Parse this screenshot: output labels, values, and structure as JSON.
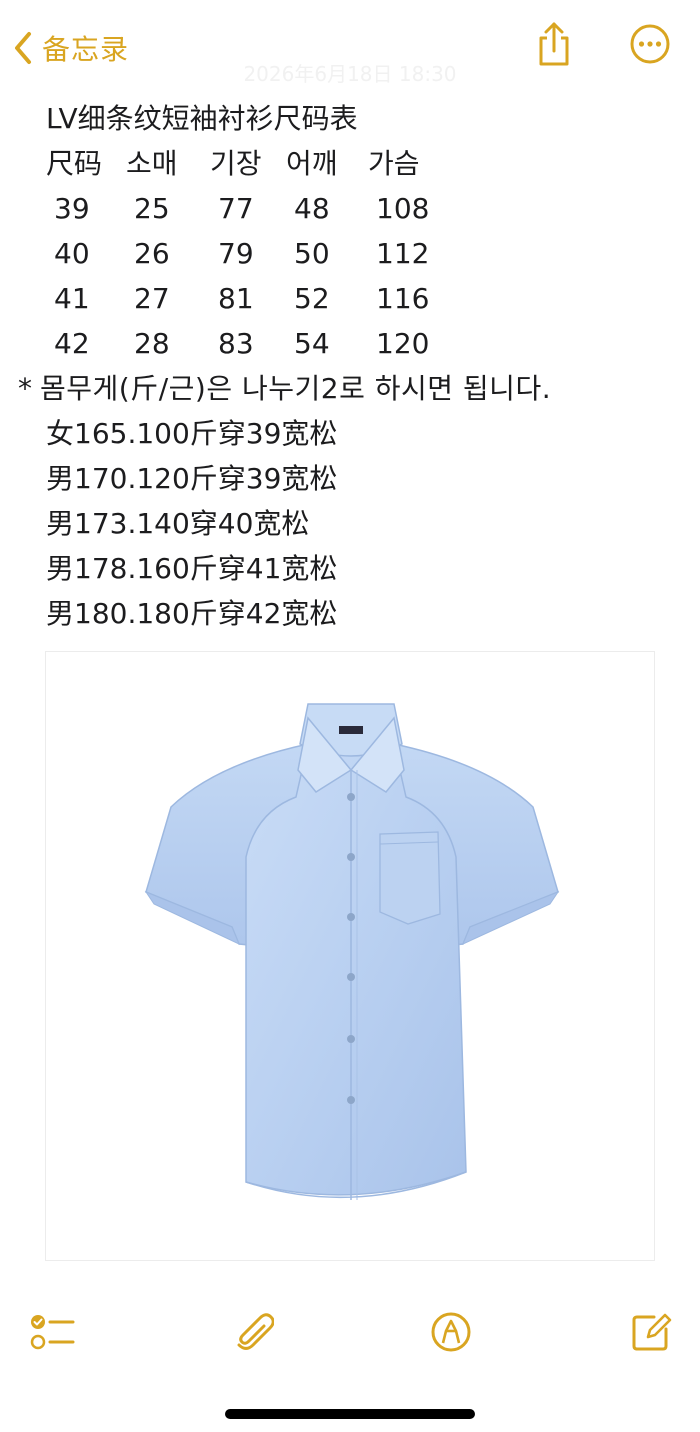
{
  "nav": {
    "back_label": "备忘录",
    "timestamp": "2026年6月18日 18:30"
  },
  "accent_color": "#d9a521",
  "icons": {
    "back": "chevron-left-icon",
    "share": "share-icon",
    "more": "more-icon",
    "checklist": "checklist-icon",
    "attach": "paperclip-icon",
    "markup": "markup-pen-icon",
    "compose": "compose-icon"
  },
  "note": {
    "title": "LV细条纹短袖衬衫尺码表",
    "table": {
      "headers": [
        "尺码",
        "소매",
        "기장",
        "어깨",
        "가슴"
      ],
      "rows": [
        [
          "39",
          "25",
          "77",
          "48",
          "108"
        ],
        [
          "40",
          "26",
          "79",
          "50",
          "112"
        ],
        [
          "41",
          "27",
          "81",
          "52",
          "116"
        ],
        [
          "42",
          "28",
          "83",
          "54",
          "120"
        ]
      ]
    },
    "notice_star": "*",
    "notice": "몸무게(斤/근)은 나누기2로 하시면 됩니다.",
    "recommendations": [
      "女165.100斤穿39宽松",
      "男170.120斤穿39宽松",
      "男173.140穿40宽松",
      "男178.160斤穿41宽松",
      "男180.180斤穿42宽松"
    ]
  }
}
